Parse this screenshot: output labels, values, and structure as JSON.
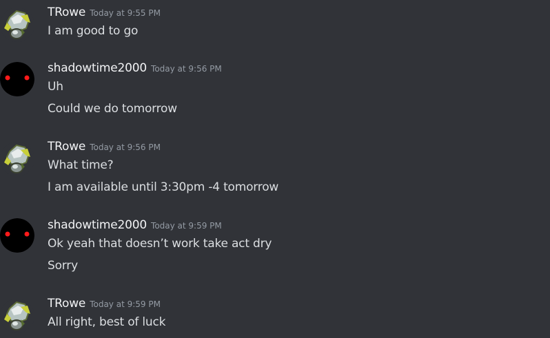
{
  "messages": [
    {
      "author": "TRowe",
      "avatar": "trowe-avatar-icon",
      "timestamp": "Today at 9:55 PM",
      "lines": [
        "I am good to go"
      ]
    },
    {
      "author": "shadowtime2000",
      "avatar": "shadowtime-avatar-icon",
      "timestamp": "Today at 9:56 PM",
      "lines": [
        "Uh",
        "Could we do tomorrow"
      ]
    },
    {
      "author": "TRowe",
      "avatar": "trowe-avatar-icon",
      "timestamp": "Today at 9:56 PM",
      "lines": [
        "What time?",
        "I am available until 3:30pm -4 tomorrow"
      ]
    },
    {
      "author": "shadowtime2000",
      "avatar": "shadowtime-avatar-icon",
      "timestamp": "Today at 9:59 PM",
      "lines": [
        "Ok yeah that doesn’t work take act dry",
        "Sorry"
      ]
    },
    {
      "author": "TRowe",
      "avatar": "trowe-avatar-icon",
      "timestamp": "Today at 9:59 PM",
      "lines": [
        "All right, best of luck"
      ]
    }
  ],
  "colors": {
    "background": "#313338",
    "username": "#f2f3f5",
    "message_text": "#dbdee1",
    "timestamp": "#949ba4",
    "shadow_avatar_bg": "#000000",
    "shadow_avatar_eyes": "#ff1a1a"
  }
}
